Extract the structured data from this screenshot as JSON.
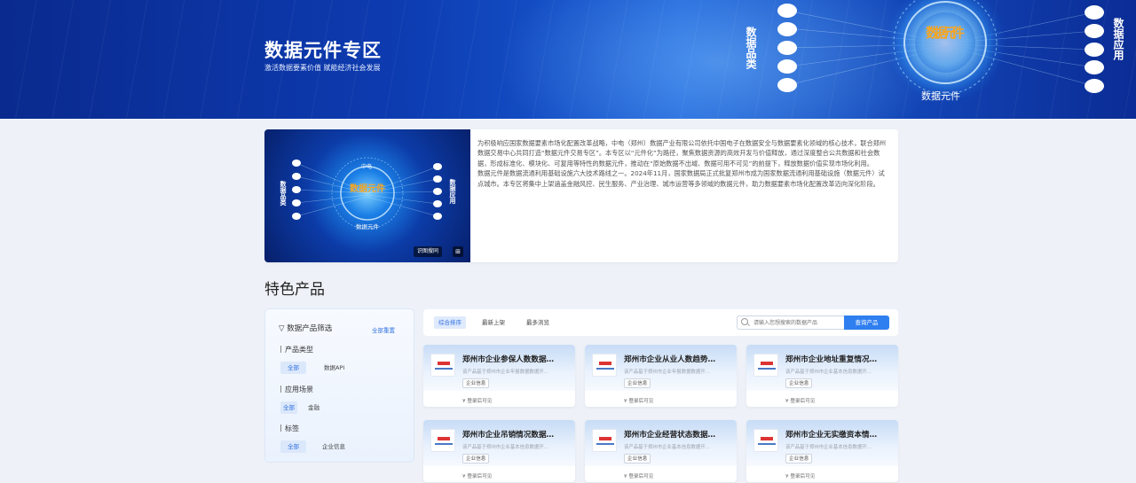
{
  "banner": {
    "title": "数据元件专区",
    "subtitle": "激活数据要素价值 赋能经济社会发展",
    "art_left_label": "数据品类",
    "art_center_label": "数据元件",
    "art_bottom_label": "数据元件",
    "art_right_label": "数据应用"
  },
  "intro": {
    "image": {
      "left_label": "数据品类",
      "center_label": "数据元件",
      "right_label": "数据应用",
      "top_label": "中电",
      "bottom_label": "数据元件",
      "video_button": "识图搜同",
      "more_icon": "⊞"
    },
    "paragraphs": [
      "为积极响应国家数据要素市场化配置改革战略，中电（郑州）数据产业有限公司依托中国电子在数据安全与数据要素化领域的核心技术，联合郑州数据交易中心共同打造“数据元件交易专区”。本专区以“元件化”为路径，聚焦数据资源的高效开发与价值释放，通过深度整合公共数据和社会数据，形成标准化、模块化、可复用等特性的数据元件，推动在“原始数据不出域、数据可用不可见”的前提下，释放数据价值实现市场化利用。",
      "数据元件是数据流通利用基础设施六大技术路线之一。2024年11月，国家数据局正式批复郑州市成为国家数据流通利用基础设施（数据元件）试点城市。本专区将集中上架涵盖金融风控、民生服务、产业治理、城市运营等多领域的数据元件，助力数据要素市场化配置改革迈向深化阶段。"
    ]
  },
  "section_title": "特色产品",
  "filter": {
    "header": "数据产品筛选",
    "reset": "全部重置",
    "groups": [
      {
        "label": "产品类型",
        "options": [
          "全部",
          "数据API"
        ]
      },
      {
        "label": "应用场景",
        "options": [
          "全部",
          "金融"
        ]
      },
      {
        "label": "标签",
        "options": [
          "全部",
          "企业信息"
        ]
      }
    ]
  },
  "toolbar": {
    "sorts": [
      "综合排序",
      "最新上架",
      "最多浏览"
    ],
    "search_placeholder": "请输入您想搜索的数据产品",
    "search_button": "查询产品"
  },
  "products": [
    {
      "title": "郑州市企业参保人数数据…",
      "desc": "该产品基于郑州市企业年报数据数据开…",
      "tag": "企业信息",
      "price": "¥ 登录后可见"
    },
    {
      "title": "郑州市企业从业人数趋势…",
      "desc": "该产品基于郑州市企业年报数据数据开…",
      "tag": "企业信息",
      "price": "¥ 登录后可见"
    },
    {
      "title": "郑州市企业地址重复情况…",
      "desc": "该产品基于郑州市企业基本信息数据开…",
      "tag": "企业信息",
      "price": "¥ 登录后可见"
    },
    {
      "title": "郑州市企业吊销情况数据…",
      "desc": "该产品基于郑州市企业基本信息数据开…",
      "tag": "企业信息",
      "price": "¥ 登录后可见"
    },
    {
      "title": "郑州市企业经营状态数据…",
      "desc": "该产品基于郑州市企业基本信息数据开…",
      "tag": "企业信息",
      "price": "¥ 登录后可见"
    },
    {
      "title": "郑州市企业无实缴资本情…",
      "desc": "该产品基于郑州市企业基本信息数据开…",
      "tag": "企业信息",
      "price": "¥ 登录后可见"
    }
  ]
}
